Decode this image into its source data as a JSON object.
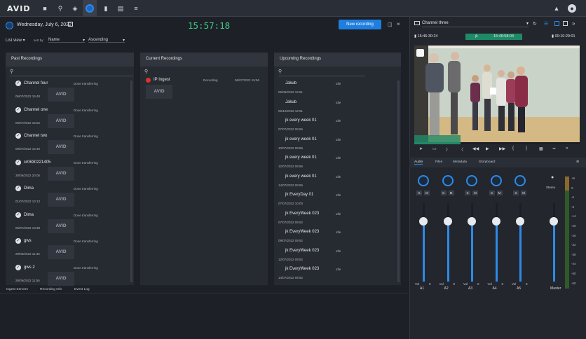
{
  "app": {
    "logo": "AVID"
  },
  "header": {
    "date": "Wednesday, July 6, 2022",
    "clock": "15:57:18",
    "new_recording": "New recording"
  },
  "filters": {
    "list_view": "List view",
    "sort_by_label": "sort by:",
    "sort_field": "Name",
    "sort_order": "Ascending"
  },
  "panels": {
    "past": "Past Recordings",
    "current": "Current Recordings",
    "upcoming": "Upcoming Recordings"
  },
  "past_recordings": [
    {
      "name": "Channel four",
      "status": "Done transferring",
      "date": "06/07/2022 15:48"
    },
    {
      "name": "Channel one",
      "status": "Done transferring",
      "date": "06/07/2022 15:52"
    },
    {
      "name": "Channel two",
      "status": "Done transferring",
      "date": "06/07/2022 15:46"
    },
    {
      "name": "cr0630221405",
      "status": "Done transferring",
      "date": "30/06/2022 20:05"
    },
    {
      "name": "Dima",
      "status": "Done transferring",
      "date": "01/07/2022 13:13"
    },
    {
      "name": "Dima",
      "status": "Done transferring",
      "date": "06/07/2022 13:38"
    },
    {
      "name": "gws",
      "status": "Done transferring",
      "date": "29/06/2022 11:36"
    },
    {
      "name": "gws 2",
      "status": "Done transferring",
      "date": "29/06/2022 11:56"
    }
  ],
  "current_recording": {
    "name": "IP Ingest",
    "status": "Recording",
    "date": "06/07/2022 15:56"
  },
  "upcoming_recordings": [
    {
      "name": "Jakub",
      "status": "Idle",
      "date": "06/09/2022 12:51"
    },
    {
      "name": "Jakub",
      "status": "Idle",
      "date": "06/12/2022 12:51"
    },
    {
      "name": "jk every week 01",
      "status": "Idle",
      "date": "07/07/2022 09:56"
    },
    {
      "name": "jk every week 01",
      "status": "Idle",
      "date": "10/07/2022 09:56"
    },
    {
      "name": "jk every week 01",
      "status": "Idle",
      "date": "12/07/2022 09:56"
    },
    {
      "name": "jk every week 01",
      "status": "Idle",
      "date": "14/07/2022 09:56"
    },
    {
      "name": "jk EveryDay 01",
      "status": "Idle",
      "date": "07/07/2022 10:00"
    },
    {
      "name": "jk EveryWeek 023",
      "status": "Idle",
      "date": "07/07/2022 09:52"
    },
    {
      "name": "jk EveryWeek 023",
      "status": "Idle",
      "date": "09/07/2022 09:52"
    },
    {
      "name": "jk EveryWeek 023",
      "status": "Idle",
      "date": "12/07/2022 09:52"
    },
    {
      "name": "jk EveryWeek 023",
      "status": "Idle",
      "date": "14/07/2022 09:52"
    }
  ],
  "bottom_tabs": [
    "Ingest Servers",
    "Recording Info",
    "Event Log"
  ],
  "monitor": {
    "channel": "Channel three",
    "tc_left": "15:46:30:24",
    "tc_mid": "15:46:58:04",
    "tc_right": "00:10:29:01",
    "jk_label": "jk"
  },
  "audio_tabs": [
    "Audio",
    "Files",
    "Metadata",
    "Storyboard"
  ],
  "mixer": {
    "channels": [
      "A1",
      "A2",
      "A3",
      "A4",
      "A5"
    ],
    "vol_label": "Vol",
    "vol_value": "0",
    "stereo": "Stereo",
    "master": "Master"
  },
  "meter_scale": [
    "+6",
    "0",
    "-6",
    "-8",
    "-14",
    "-20",
    "-26",
    "-32",
    "-38",
    "-44",
    "-50",
    "-60"
  ],
  "colors": {
    "accent": "#2e8ae6",
    "clock": "#3fd08a",
    "recording": "#d9342b"
  }
}
